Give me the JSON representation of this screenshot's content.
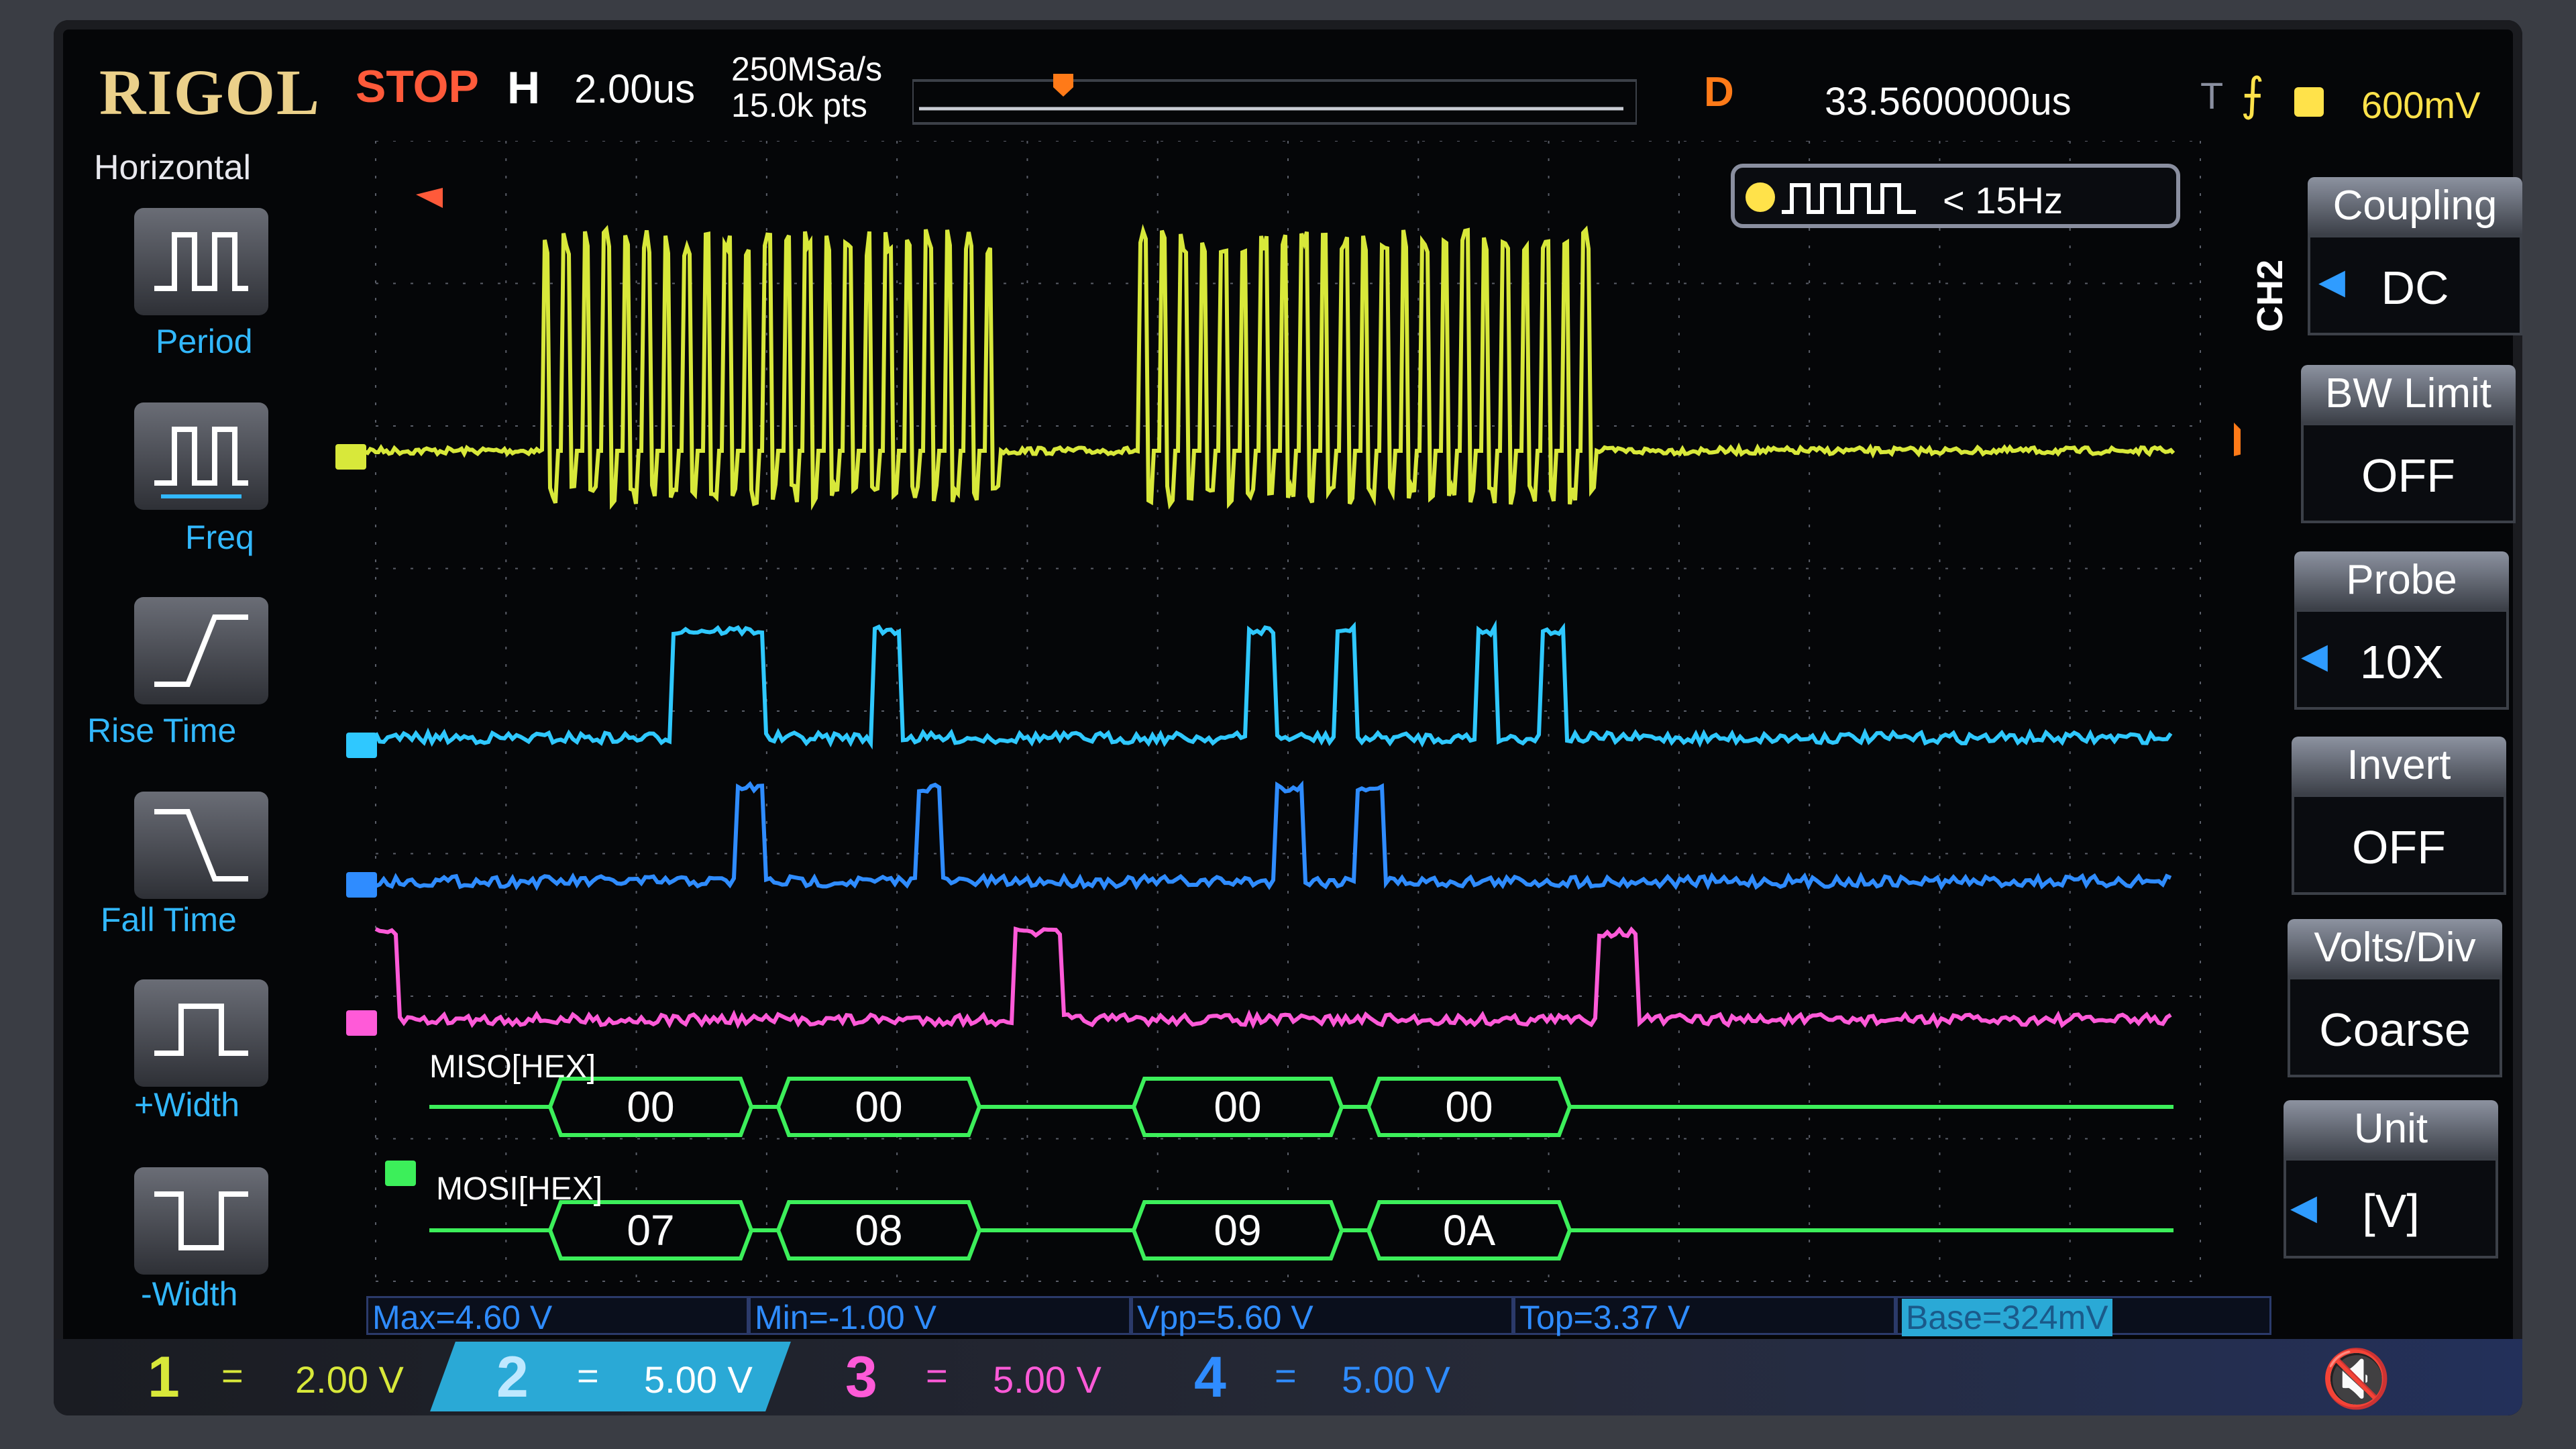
{
  "brand": "RIGOL",
  "status": "STOP",
  "horizontal": {
    "label": "H",
    "timebase": "2.00us",
    "sample_rate": "250MSa/s",
    "memory": "15.0k pts"
  },
  "delay": {
    "label": "D",
    "value": "33.5600000us"
  },
  "trigger": {
    "label": "T",
    "edge_icon": "rising-edge-icon",
    "channel": "1",
    "level": "600mV"
  },
  "freq_counter": "< 15Hz",
  "left_menu": {
    "title": "Horizontal",
    "items": [
      {
        "label": "Period",
        "icon": "period-icon"
      },
      {
        "label": "Freq",
        "icon": "freq-icon"
      },
      {
        "label": "Rise Time",
        "icon": "rise-time-icon"
      },
      {
        "label": "Fall Time",
        "icon": "fall-time-icon"
      },
      {
        "label": "+Width",
        "icon": "pos-width-icon"
      },
      {
        "label": "-Width",
        "icon": "neg-width-icon"
      }
    ]
  },
  "right_menu": {
    "channel": "CH2",
    "items": [
      {
        "title": "Coupling",
        "value": "DC"
      },
      {
        "title": "BW Limit",
        "value": "OFF"
      },
      {
        "title": "Probe",
        "value": "10X"
      },
      {
        "title": "Invert",
        "value": "OFF"
      },
      {
        "title": "Volts/Div",
        "value": "Coarse"
      },
      {
        "title": "Unit",
        "value": "[V]"
      }
    ]
  },
  "decode": {
    "miso": {
      "label": "MISO[HEX]",
      "bytes": [
        "00",
        "00",
        "00",
        "00"
      ]
    },
    "mosi": {
      "label": "MOSI[HEX]",
      "bytes": [
        "07",
        "08",
        "09",
        "0A"
      ]
    }
  },
  "measurements": [
    "Max=4.60 V",
    "Min=-1.00 V",
    "Vpp=5.60 V",
    "Top=3.37 V",
    "Base=324mV"
  ],
  "channels": [
    {
      "num": "1",
      "coupling": "=",
      "scale": "2.00 V",
      "color": "#d8e83a"
    },
    {
      "num": "2",
      "coupling": "=",
      "scale": "5.00 V",
      "color": "#2fc8ff"
    },
    {
      "num": "3",
      "coupling": "=",
      "scale": "5.00 V",
      "color": "#ff5ad8"
    },
    {
      "num": "4",
      "coupling": "=",
      "scale": "5.00 V",
      "color": "#2f8cff"
    }
  ],
  "colors": {
    "ch1": "#d8e83a",
    "ch2": "#2fc8ff",
    "ch3": "#ff5ad8",
    "ch4": "#2f8cff",
    "decode": "#3cef5a",
    "grid": "#5a5e68"
  }
}
